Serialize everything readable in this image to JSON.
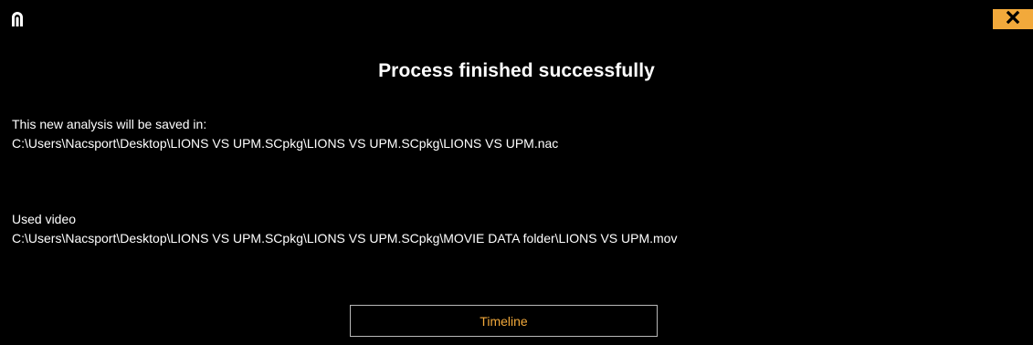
{
  "colors": {
    "background": "#000000",
    "text": "#ffffff",
    "accent": "#f2a93b",
    "button_border": "#b8b8b8"
  },
  "header": {
    "logo_icon": "nacsport-arch-icon",
    "close_icon": "close-x-icon"
  },
  "title": "Process finished successfully",
  "analysis": {
    "label": "This new analysis will be saved in:",
    "path": "C:\\Users\\Nacsport\\Desktop\\LIONS VS UPM.SCpkg\\LIONS VS UPM.SCpkg\\LIONS VS UPM.nac"
  },
  "video": {
    "label": "Used video",
    "path": "C:\\Users\\Nacsport\\Desktop\\LIONS VS UPM.SCpkg\\LIONS VS UPM.SCpkg\\MOVIE DATA folder\\LIONS VS UPM.mov"
  },
  "actions": {
    "timeline_label": "Timeline"
  }
}
